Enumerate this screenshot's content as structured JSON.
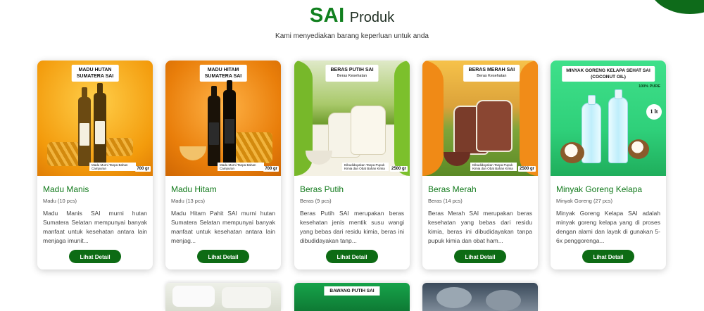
{
  "header": {
    "brand": "SAI",
    "title_word": "Produk",
    "subtitle": "Kami menyediakan barang keperluan untuk anda"
  },
  "products": [
    {
      "tag_line1": "MADU HUTAN",
      "tag_line2": "SUMATERA SAI",
      "image_caption": "Madu Murni Tanpa Bahan Campuran",
      "image_weight": "700 gr",
      "name": "Madu Manis",
      "meta": "Madu (10 pcs)",
      "description": "Madu Manis SAI murni hutan Sumatera Selatan mempunyai banyak manfaat untuk kesehatan antara lain menjaga imunit...",
      "button": "Lihat Detail"
    },
    {
      "tag_line1": "MADU HITAM",
      "tag_line2": "SUMATERA SAI",
      "image_caption": "Madu Murni Tanpa Bahan Campuran",
      "image_weight": "700 gr",
      "name": "Madu Hitam",
      "meta": "Madu (13 pcs)",
      "description": "Madu Hitam Pahit SAI murni hutan Sumatera Selatan mempunyai banyak manfaat untuk kesehatan antara lain menjag...",
      "button": "Lihat Detail"
    },
    {
      "tag_line1": "BERAS PUTIH SAI",
      "tag_line2": "Beras Kesehatan",
      "image_caption": "Dibudidayakan Tanpa Pupuk Kimia dan Obat Bahan Kimia",
      "image_weight": "2500 gr",
      "name": "Beras Putih",
      "meta": "Beras (9 pcs)",
      "description": "Beras Putih SAI merupakan beras kesehatan jenis mentik susu wangi yang bebas dari residu kimia, beras ini dibudidayakan tanp...",
      "button": "Lihat Detail"
    },
    {
      "tag_line1": "BERAS MERAH SAI",
      "tag_line2": "Beras Kesehatan",
      "image_caption": "Dibudidayakan Tanpa Pupuk Kimia dan Obat Bahan Kimia",
      "image_weight": "2500 gr",
      "name": "Beras Merah",
      "meta": "Beras (14 pcs)",
      "description": "Beras Merah SAI merupakan beras kesehatan yang bebas dari residu kimia, beras ini dibudidayakan tanpa pupuk kimia dan obat ham...",
      "button": "Lihat Detail"
    },
    {
      "tag_line1": "MINYAK GORENG KELAPA SEHAT SAI",
      "tag_line2": "(COCONUT OIL)",
      "image_caption": "100% PURE",
      "image_weight": "1 lt",
      "name": "Minyak Goreng Kelapa",
      "meta": "Minyak Goreng (27 pcs)",
      "description": "Minyak Goreng Kelapa SAI adalah minyak goreng kelapa yang di proses dengan alami dan layak di gunakan 5-6x penggorenga...",
      "button": "Lihat Detail"
    }
  ],
  "next_row": {
    "middle_tag": "BAWANG PUTIH SAI"
  }
}
